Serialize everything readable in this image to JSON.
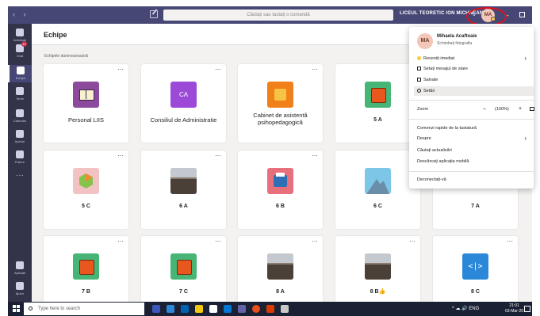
{
  "titlebar": {
    "nav": "‹ ›",
    "search_placeholder": "Căutați sau tastați o comandă",
    "org_name": "LICEUL TEORETIC ION MICHNEANUL",
    "org_chevron": "⌄",
    "avatar_initials": "MA",
    "minimize": "–",
    "close": "✕"
  },
  "rail": [
    {
      "label": "Activitate",
      "icon": "bell-icon"
    },
    {
      "label": "Chat",
      "icon": "chat-icon",
      "badge": "10"
    },
    {
      "label": "Echipe",
      "icon": "teams-icon",
      "active": true
    },
    {
      "label": "Teme",
      "icon": "assignments-icon"
    },
    {
      "label": "Calendar",
      "icon": "calendar-icon"
    },
    {
      "label": "Apeluri",
      "icon": "phone-icon"
    },
    {
      "label": "Fișiere",
      "icon": "files-icon"
    }
  ],
  "rail_more": "···",
  "rail_bottom": [
    {
      "label": "Aplicații",
      "icon": "apps-icon"
    },
    {
      "label": "Ajutor",
      "icon": "help-icon"
    }
  ],
  "header": {
    "title": "Echipe"
  },
  "section_label": "Echipele dumneavoastră",
  "teams": [
    {
      "name": "Personal LIIS",
      "tile": "book",
      "row": 0,
      "col": 0
    },
    {
      "name": "Consiliul de Administratie",
      "tile": "ca",
      "tile_text": "CA",
      "row": 0,
      "col": 1
    },
    {
      "name": "Cabinet de asistentă psihopedagogică",
      "tile": "puzzle",
      "row": 0,
      "col": 2
    },
    {
      "name": "5 A",
      "tile": "orange",
      "row": 0,
      "col": 3
    },
    {
      "name": "5 C",
      "tile": "hex",
      "row": 1,
      "col": 0
    },
    {
      "name": "6 A",
      "tile": "photo",
      "row": 1,
      "col": 1
    },
    {
      "name": "6 B",
      "tile": "printer",
      "row": 1,
      "col": 2
    },
    {
      "name": "6 C",
      "tile": "mountain",
      "row": 1,
      "col": 3
    },
    {
      "name": "7 A",
      "tile": "none",
      "row": 1,
      "col": 4
    },
    {
      "name": "7 B",
      "tile": "orange",
      "row": 2,
      "col": 0
    },
    {
      "name": "7 C",
      "tile": "orange",
      "row": 2,
      "col": 1
    },
    {
      "name": "8 A",
      "tile": "photo",
      "row": 2,
      "col": 2
    },
    {
      "name": "8 B👍",
      "tile": "photo",
      "row": 2,
      "col": 3
    },
    {
      "name": "8 C",
      "tile": "code",
      "tile_text": "<|>",
      "row": 2,
      "col": 4
    }
  ],
  "card_more": "···",
  "popup": {
    "avatar": "MA",
    "name": "Mihaela Acaftoaie",
    "subtitle": "Schimbați fotografia",
    "status": "Reveniți imediat",
    "status_message": "Setați mesajul de stare",
    "saved": "Salvate",
    "settings": "Setări",
    "zoom_label": "Zoom",
    "zoom_minus": "–",
    "zoom_value": "(100%)",
    "zoom_plus": "+",
    "shortcuts": "Comenzi rapide de la tastatură",
    "about": "Despre",
    "check_updates": "Căutați actualizări",
    "download_mobile": "Descărcați aplicația mobilă",
    "signout": "Deconectați-vă",
    "chevron": "›"
  },
  "taskbar": {
    "search_placeholder": "Type here to search",
    "tray": "^ ☁ 🔊 ENG",
    "time": "21:01",
    "date": "03-Mar-20"
  },
  "colors": {
    "titlebar": "#464775",
    "rail": "#33344a",
    "background": "#f3f2f1",
    "highlight": "#e0111d",
    "away": "#ffc83d"
  }
}
